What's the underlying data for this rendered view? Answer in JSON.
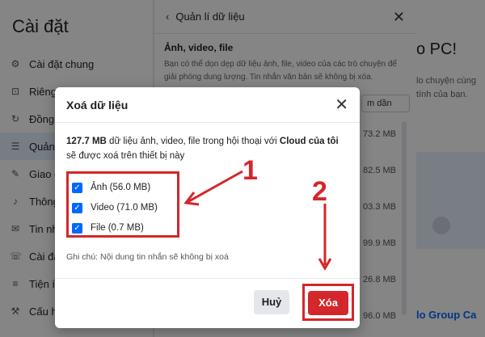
{
  "settings": {
    "title": "Cài đặt",
    "items": [
      {
        "label": "Cài đặt chung",
        "icon": "gear-icon"
      },
      {
        "label": "Riêng",
        "icon": "lock-icon"
      },
      {
        "label": "Đồng",
        "icon": "sync-icon"
      },
      {
        "label": "Quản",
        "icon": "database-icon"
      },
      {
        "label": "Giao d",
        "icon": "edit-icon"
      },
      {
        "label": "Thông",
        "icon": "bell-icon"
      },
      {
        "label": "Tin nh",
        "icon": "message-icon"
      },
      {
        "label": "Cài đặ",
        "icon": "phone-icon"
      },
      {
        "label": "Tiện íc",
        "icon": "list-icon"
      },
      {
        "label": "Cấu h",
        "icon": "wrench-icon"
      }
    ],
    "active_index": 3
  },
  "data_panel": {
    "title": "Quản lí dữ liệu",
    "section_title": "Ảnh, video, file",
    "section_desc": "Bạn có thể dọn dẹp dữ liệu ảnh, file, video của các trò chuyện để giải phóng dung lượng. Tin nhắn văn bản sẽ không bị xóa.",
    "sort_label": "m dần",
    "sizes": [
      "73.2 MB",
      "82.5 MB",
      "03.3 MB",
      "99.9 MB",
      "26.8 MB",
      "96.0 MB"
    ]
  },
  "background": {
    "pc_title": "o PC!",
    "pc_desc": "lo chuyện cùng tính của bạn.",
    "group_title": "lo Group Ca"
  },
  "dialog": {
    "title": "Xoá dữ liệu",
    "size": "127.7 MB",
    "summary_mid": " dữ liệu ảnh, video, file trong hội thoại với ",
    "cloud": "Cloud của tôi",
    "summary_end": " sẽ được xoá trên thiết bị này",
    "options": [
      {
        "label": "Ảnh (56.0 MB)",
        "checked": true
      },
      {
        "label": "Video (71.0 MB)",
        "checked": true
      },
      {
        "label": "File (0.7 MB)",
        "checked": true
      }
    ],
    "note": "Ghi chú: Nội dung tin nhắn sẽ không bị xoá",
    "cancel_label": "Huỷ",
    "delete_label": "Xóa"
  },
  "annotations": {
    "step1": "1",
    "step2": "2",
    "color": "#d3272b"
  },
  "colors": {
    "accent": "#0068ff",
    "danger": "#d3272b"
  }
}
